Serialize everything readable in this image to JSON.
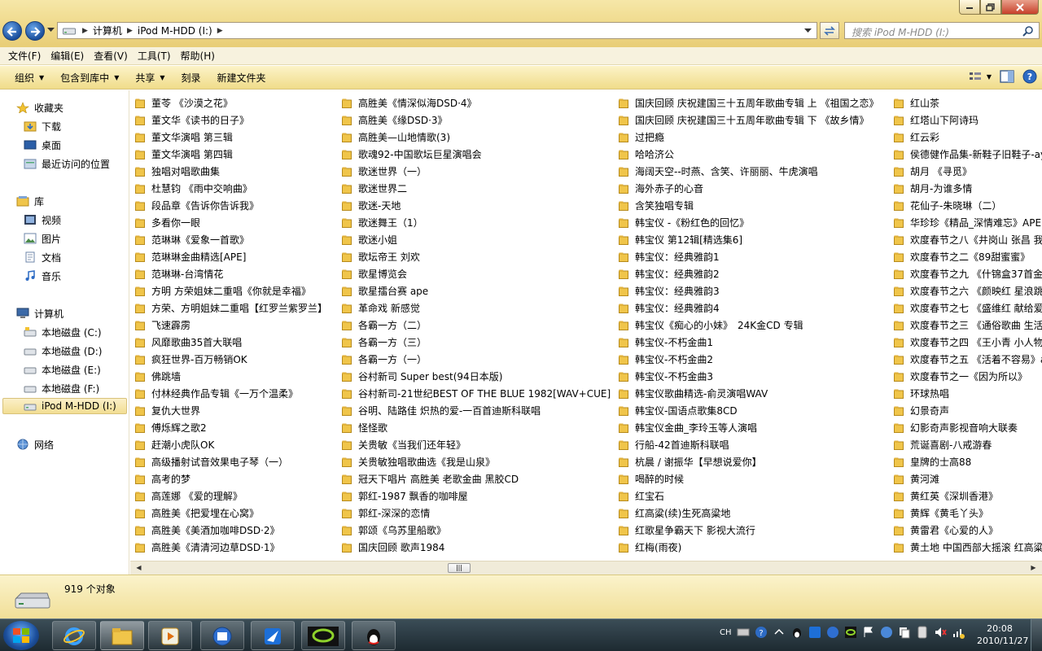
{
  "address": {
    "crumbs": [
      "计算机",
      "iPod M-HDD (I:)"
    ],
    "search_placeholder": "搜索 iPod M-HDD (I:)"
  },
  "menu": [
    "文件(F)",
    "编辑(E)",
    "查看(V)",
    "工具(T)",
    "帮助(H)"
  ],
  "commands": {
    "organize": "组织",
    "include_library": "包含到库中",
    "share": "共享",
    "burn": "刻录",
    "new_folder": "新建文件夹"
  },
  "nav": {
    "favorites": "收藏夹",
    "downloads": "下载",
    "desktop": "桌面",
    "recent": "最近访问的位置",
    "libraries": "库",
    "videos": "视频",
    "pictures": "图片",
    "documents": "文档",
    "music": "音乐",
    "computer": "计算机",
    "drive_c": "本地磁盘 (C:)",
    "drive_d": "本地磁盘 (D:)",
    "drive_e": "本地磁盘 (E:)",
    "drive_f": "本地磁盘 (F:)",
    "drive_i": "iPod M-HDD (I:)",
    "network": "网络"
  },
  "files": {
    "col1": [
      "董苓 《沙漠之花》",
      "董文华《读书的日子》",
      "董文华演唱 第三辑",
      "董文华演唱 第四辑",
      "独唱对唱歌曲集",
      "杜慧钧 《雨中交响曲》",
      "段品章《告诉你告诉我》",
      "多看你一眼",
      "范琳琳《爱象一首歌》",
      "范琳琳金曲精选[APE]",
      "范琳琳-台湾情花",
      "方明 方荣姐妹二重唱《你就是幸福》",
      "方荣、方明姐妹二重唱【红罗兰紫罗兰】",
      "飞速霹雳",
      "风靡歌曲35首大联唱",
      "疯狂世界-百万畅销OK",
      "佛跳墙",
      "付林经典作品专辑《一万个温柔》",
      "复仇大世界",
      "傅烁辉之歌2",
      "赶潮小虎队OK",
      "高级播射试音效果电子琴（一）",
      "高考的梦",
      "高莲娜 《爱的理解》",
      "高胜美《把爱埋在心窝》",
      "高胜美《美酒加咖啡DSD·2》",
      "高胜美《清清河边草DSD·1》"
    ],
    "col2": [
      "高胜美《情深似海DSD·4》",
      "高胜美《缘DSD·3》",
      "高胜美—山地情歌(3)",
      "歌魂92-中国歌坛巨星演唱会",
      "歌迷世界（一）",
      "歌迷世界二",
      "歌迷-天地",
      "歌迷舞王（1）",
      "歌迷小姐",
      "歌坛帝王 刘欢",
      "歌星博览会",
      "歌星擂台赛 ape",
      "革命戏 新感觉",
      "各霸一方（二）",
      "各霸一方（三）",
      "各霸一方（一）",
      "谷村新司 Super best(94日本版)",
      "谷村新司-21世纪BEST OF THE BLUE 1982[WAV+CUE]",
      "谷明、陆路佳 炽热的爱-一百首迪斯科联唱",
      "怪怪歌",
      "关贵敏《当我们还年轻》",
      "关贵敏独唱歌曲选《我是山泉》",
      "冠天下唱片 高胜美 老歌金曲 黑胶CD",
      "郭红-1987 飘香的咖啡屋",
      "郭红-深深的恋情",
      "郭颂《乌苏里船歌》",
      "国庆回顾 歌声1984"
    ],
    "col3": [
      "国庆回顾 庆祝建国三十五周年歌曲专辑 上 《祖国之恋》",
      "国庆回顾 庆祝建国三十五周年歌曲专辑 下 《故乡情》",
      "过把瘾",
      "哈哈济公",
      "海阔天空--时燕、含笑、许丽丽、牛虎演唱",
      "海外赤子的心音",
      "含笑独唱专辑",
      "韩宝仪 -《粉红色的回忆》",
      "韩宝仪 第12辑[精选集6]",
      "韩宝仪：经典雅韵1",
      "韩宝仪：经典雅韵2",
      "韩宝仪：经典雅韵3",
      "韩宝仪：经典雅韵4",
      "韩宝仪《痴心的小妹》　24K金CD 专辑",
      "韩宝仪-不朽金曲1",
      "韩宝仪-不朽金曲2",
      "韩宝仪-不朽金曲3",
      "韩宝仪歌曲精选-俞灵演唱WAV",
      "韩宝仪-国语点歌集8CD",
      "韩宝仪金曲_李玲玉等人演唱",
      "行船-42首迪斯科联唱",
      "杭晨 / 谢振华【早想说爱你】",
      "喝醉的时候",
      "红宝石",
      "红高粱(续)生死高粱地",
      "红歌星争霸天下 影视大流行",
      "红梅(雨夜)"
    ],
    "col4": [
      "红山茶",
      "红塔山下阿诗玛",
      "红云彩",
      "侯德健作品集-新鞋子旧鞋子-ay",
      "胡月 《寻觅》",
      "胡月-为谁多情",
      "花仙子-朱晓琳（二）",
      "华珍珍《精品_深情难忘》APE",
      "欢度春节之八《井岗山 张昌 我",
      "欢度春节之二《89甜蜜蜜》",
      "欢度春节之九 《什锦盒37首金曲",
      "欢度春节之六 《颜映红 星浪跳",
      "欢度春节之七 《盛维红 献给爱",
      "欢度春节之三 《通俗歌曲 生活",
      "欢度春节之四 《王小青 小人物",
      "欢度春节之五 《活着不容易》a",
      "欢度春节之一《因为所以》",
      "环球热唱",
      "幻景奇声",
      "幻影奇声影视音响大联奏",
      "荒诞喜剧-八戒游春",
      "皇牌的士高88",
      "黄河滩",
      "黄红英《深圳香港》",
      "黄辉《黄毛丫头》",
      "黄雷君《心爱的人》",
      "黄土地 中国西部大摇滚 红高粱"
    ]
  },
  "status": {
    "count": "919 个对象"
  },
  "taskbar": {
    "tray_lang": "CH",
    "time": "20:08",
    "date": "2010/11/27"
  }
}
